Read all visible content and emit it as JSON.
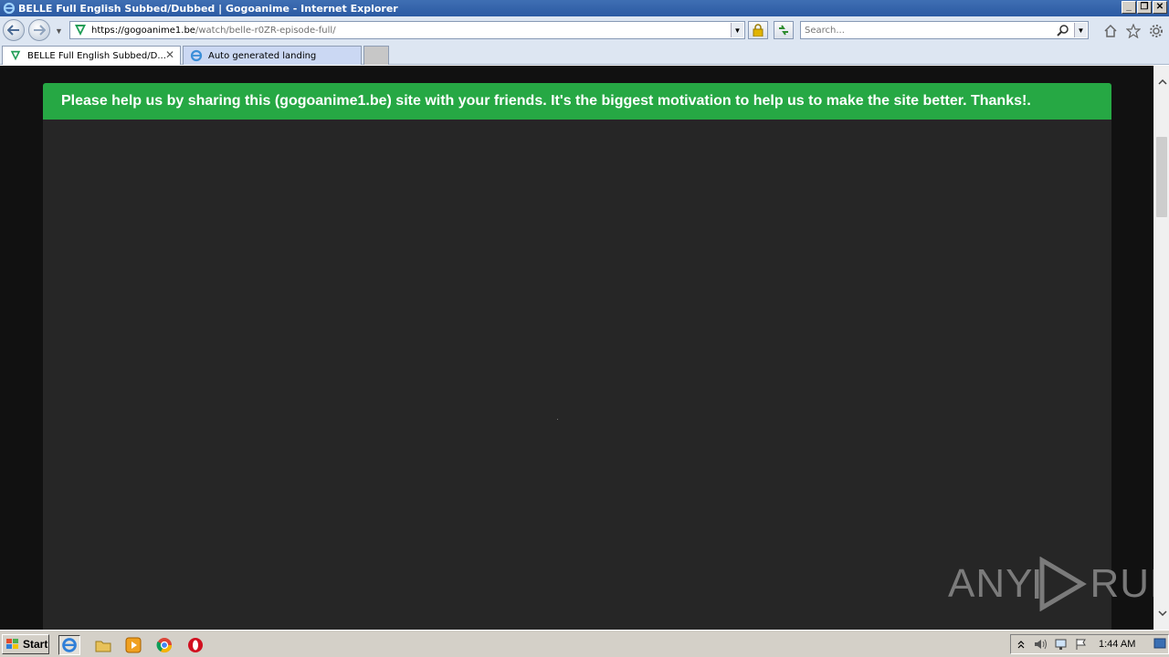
{
  "window": {
    "title": "BELLE Full English Subbed/Dubbed | Gogoanime - Internet Explorer",
    "minimize_label": "_",
    "restore_label": "❐",
    "close_label": "✕"
  },
  "address_bar": {
    "url_host": "https://gogoanime1.be",
    "url_path": "/watch/belle-r0ZR-episode-full/"
  },
  "search": {
    "placeholder": "Search..."
  },
  "tabs": [
    {
      "label": "BELLE Full English Subbed/D...",
      "active": true,
      "icon": "gogoanime-icon"
    },
    {
      "label": "Auto generated landing",
      "active": false,
      "icon": "ie-icon"
    }
  ],
  "page": {
    "banner_text": "Please help us by sharing this (gogoanime1.be) site with your friends. It's the biggest motivation to help us to make the site better. Thanks!.",
    "banner_color": "#26a844",
    "player_background": "#262626"
  },
  "watermark": {
    "left_text": "ANY",
    "right_text": "RUN"
  },
  "taskbar": {
    "start_label": "Start",
    "clock": "1:44 AM",
    "pinned": [
      "internet-explorer-icon",
      "explorer-folder-icon",
      "media-player-icon",
      "chrome-icon",
      "opera-icon"
    ]
  }
}
